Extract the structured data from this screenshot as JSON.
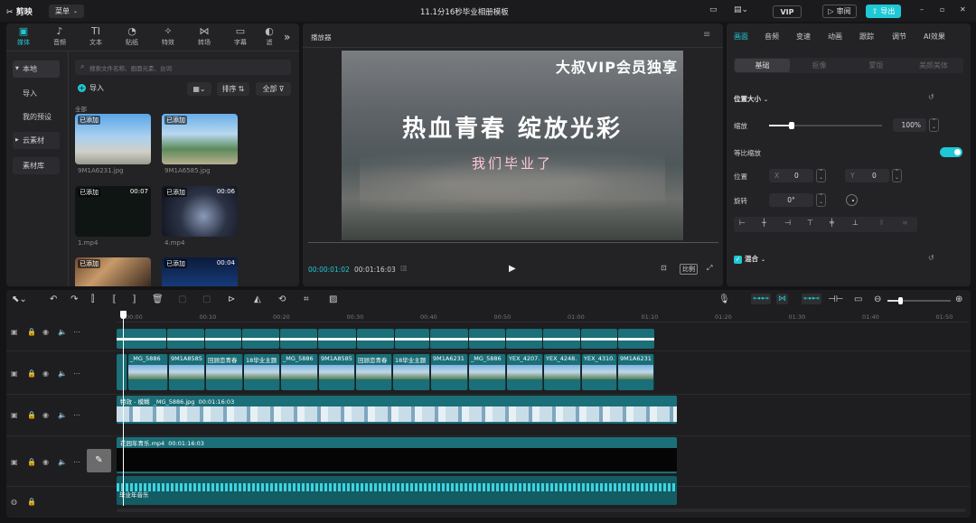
{
  "app": {
    "logo": "剪映",
    "menu": "菜单",
    "title": "11.1分16秒毕业相册模板",
    "vip": "VIP",
    "review": "审阅",
    "export": "导出"
  },
  "media_tabs": [
    {
      "label": "媒体",
      "icon": "▣"
    },
    {
      "label": "音频",
      "icon": "♪"
    },
    {
      "label": "文本",
      "icon": "TI"
    },
    {
      "label": "贴纸",
      "icon": "◔"
    },
    {
      "label": "特效",
      "icon": "✧"
    },
    {
      "label": "转场",
      "icon": "⋈"
    },
    {
      "label": "字幕",
      "icon": "▭"
    },
    {
      "label": "滤",
      "icon": "◐"
    }
  ],
  "left_nav": {
    "local": "本地",
    "import": "导入",
    "presets": "我的预设",
    "cloud": "云素材",
    "library": "素材库"
  },
  "media": {
    "search_placeholder": "搜索文件名称、画面元素、台词",
    "import": "导入",
    "sort": "排序",
    "all": "全部",
    "group": "全部",
    "items": [
      {
        "badge": "已添加",
        "name": "9M1A6231.jpg",
        "dur": ""
      },
      {
        "badge": "已添加",
        "name": "9M1A6585.jpg",
        "dur": ""
      },
      {
        "badge": "已添加",
        "name": "1.mp4",
        "dur": "00:07"
      },
      {
        "badge": "已添加",
        "name": "4.mp4",
        "dur": "00:06"
      },
      {
        "badge": "已添加",
        "name": "",
        "dur": ""
      },
      {
        "badge": "已添加",
        "name": "",
        "dur": "00:04"
      }
    ]
  },
  "player": {
    "title": "播放器",
    "vip_text": "大叔VIP会员独享",
    "headline": "热血青春 绽放光彩",
    "sub": "我们毕业了",
    "current": "00:00:01:02",
    "total": "00:01:16:03",
    "ratio": "比例"
  },
  "right": {
    "tabs": [
      "画面",
      "音频",
      "变速",
      "动画",
      "跟踪",
      "调节",
      "AI效果"
    ],
    "subtabs": [
      "基础",
      "抠像",
      "蒙版",
      "美颜美体"
    ],
    "section_size": "位置大小",
    "scale_label": "缩放",
    "scale_value": "100%",
    "scale_fraction": 0.2,
    "ratio_lock": "等比缩放",
    "position": "位置",
    "x_label": "X",
    "x_value": "0",
    "y_label": "Y",
    "y_value": "0",
    "rotate": "旋转",
    "rotate_value": "0°",
    "blend": "混合"
  },
  "timeline": {
    "ruler": [
      "00:00",
      "00:10",
      "00:20",
      "00:30",
      "00:40",
      "00:50",
      "01:00",
      "01:10",
      "01:20",
      "01:30",
      "01:40",
      "01:50"
    ],
    "clips": [
      "_MG_5886",
      "9M1A8585",
      "回顾恋青春",
      "18毕业主题",
      "_MG_5886",
      "9M1A8585",
      "回顾恋青春",
      "18毕业主题",
      "9M1A6231",
      "_MG_5886",
      "YEX_4207.",
      "YEX_4248.",
      "YEX_4310.",
      "9M1A6231"
    ],
    "effect": "特效 - 模糊  _MG_5886.jpg  00:01:16:03",
    "video2": "花园年青乐.mp4  00:01:16:03",
    "audio": "毕业年音乐"
  },
  "colors": {
    "accent": "#1ec8d4",
    "bg": "#141416",
    "panel": "#232326",
    "clip": "#1a6f78"
  }
}
